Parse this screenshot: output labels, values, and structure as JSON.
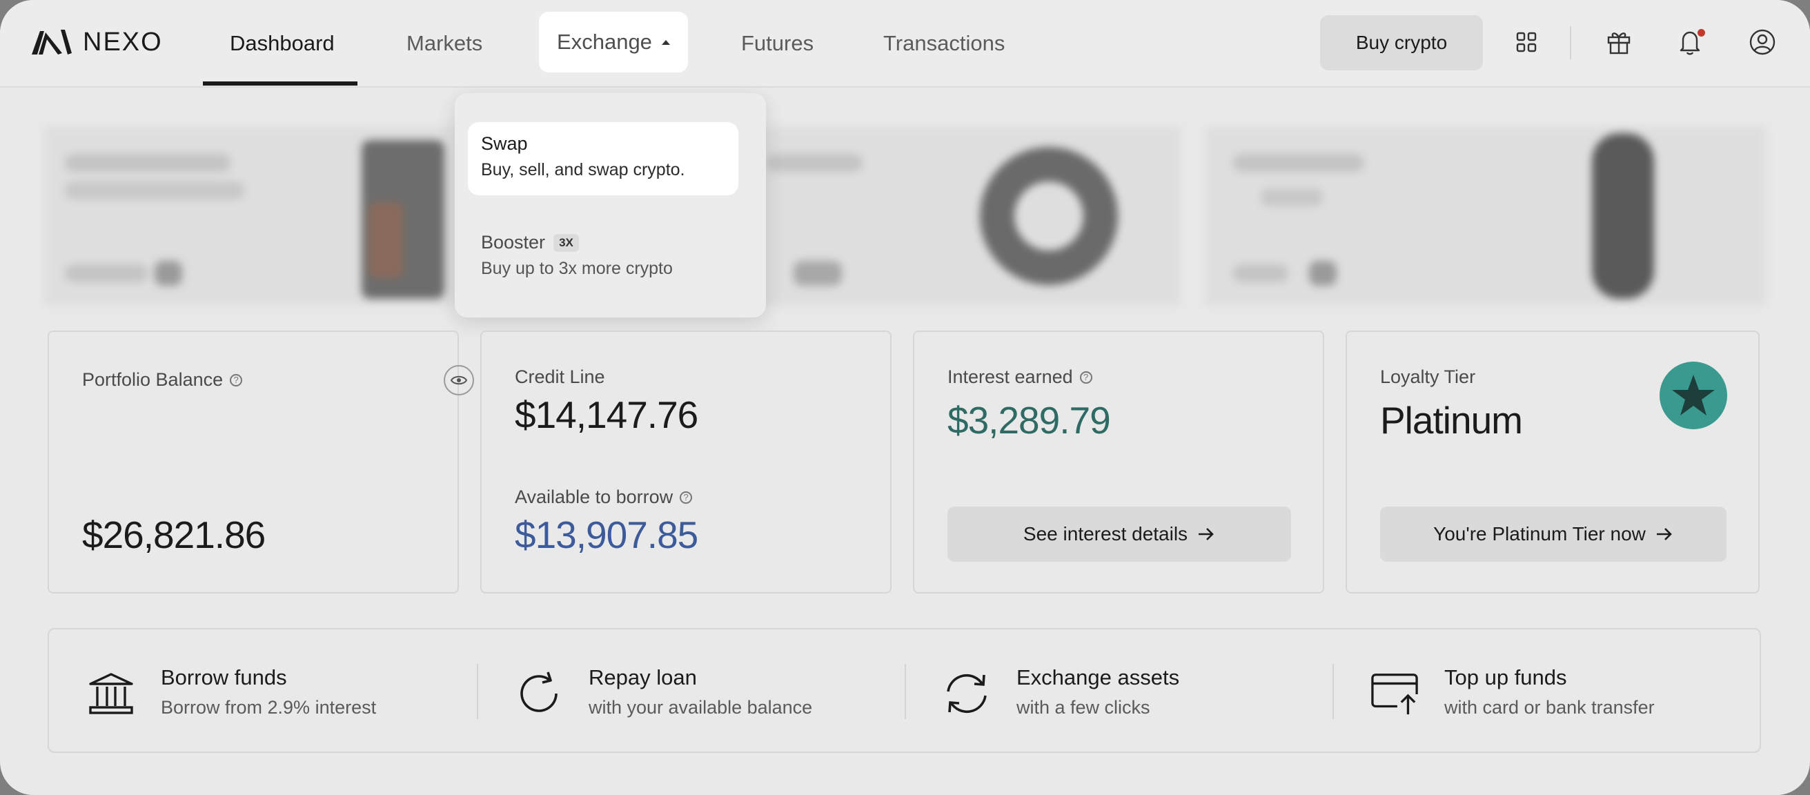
{
  "brand": {
    "name": "NEXO"
  },
  "nav": {
    "items": [
      {
        "label": "Dashboard"
      },
      {
        "label": "Markets"
      },
      {
        "label": "Exchange"
      },
      {
        "label": "Futures"
      },
      {
        "label": "Transactions"
      }
    ],
    "active": "Dashboard",
    "open_menu": "Exchange"
  },
  "header": {
    "buy_label": "Buy crypto",
    "icons": [
      "apps-grid-icon",
      "gift-icon",
      "bell-icon",
      "user-icon"
    ]
  },
  "exchange_menu": {
    "items": [
      {
        "title": "Swap",
        "subtitle": "Buy, sell, and swap crypto.",
        "selected": true
      },
      {
        "title": "Booster",
        "badge": "3X",
        "subtitle": "Buy up to 3x more crypto",
        "selected": false
      }
    ]
  },
  "cards": {
    "portfolio": {
      "label": "Portfolio Balance",
      "value": "$26,821.86"
    },
    "credit": {
      "label": "Credit Line",
      "value": "$14,147.76",
      "borrow_label": "Available to borrow",
      "borrow_value": "$13,907.85"
    },
    "interest": {
      "label": "Interest earned",
      "value": "$3,289.79",
      "button": "See interest details"
    },
    "loyalty": {
      "label": "Loyalty Tier",
      "value": "Platinum",
      "button": "You're Platinum Tier now"
    }
  },
  "actions": [
    {
      "title": "Borrow funds",
      "subtitle": "Borrow from 2.9% interest",
      "icon": "bank-icon"
    },
    {
      "title": "Repay loan",
      "subtitle": "with your available balance",
      "icon": "refresh-icon"
    },
    {
      "title": "Exchange assets",
      "subtitle": "with a few clicks",
      "icon": "exchange-icon"
    },
    {
      "title": "Top up funds",
      "subtitle": "with card or bank transfer",
      "icon": "card-topup-icon"
    }
  ],
  "colors": {
    "accent_teal": "#2e6b64",
    "accent_blue": "#3d5b9a",
    "tier_badge": "#3a9a8f",
    "notification": "#c0392b"
  }
}
